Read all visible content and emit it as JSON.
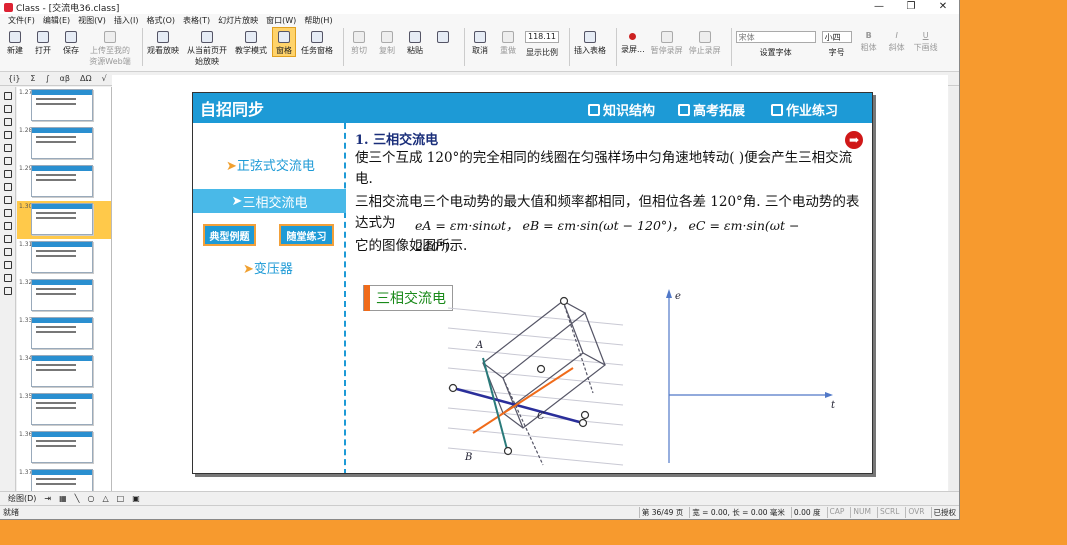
{
  "window": {
    "title": "Class - [交流电36.class]",
    "min": "—",
    "max": "❐",
    "close": "✕"
  },
  "menu": [
    "文件(F)",
    "编辑(E)",
    "视图(V)",
    "插入(I)",
    "格式(O)",
    "表格(T)",
    "幻灯片放映",
    "窗口(W)",
    "帮助(H)"
  ],
  "toolbar": {
    "new": "新建",
    "open": "打开",
    "save": "保存",
    "upload": "上传至我的资源Web端",
    "watch": "观看放映",
    "from_page": "从当前页开始放映",
    "teach_mode": "教学模式",
    "outline": "窗格",
    "task_pane": "任务窗格",
    "cut": "剪切",
    "copy": "复制",
    "paste": "粘贴",
    "undo": "取消",
    "redo": "重做",
    "zoom_value": "118.11",
    "zoom_label": "显示比例",
    "insert_table": "插入表格",
    "record": "录屏...",
    "pause_record": "暂停录屏",
    "stop_record": "停止录屏",
    "font_value": "宋体",
    "font_label": "设置字体",
    "size_value": "小四",
    "size_label": "字号",
    "bold": "粗体",
    "italic": "斜体",
    "underline": "下画线"
  },
  "toolbar2": [
    "{i}",
    "Σ",
    "∫",
    "αβ",
    "ΔΩ",
    "√",
    "∠",
    "±"
  ],
  "thumbnails": [
    "1.27",
    "1.28",
    "1.29",
    "1.30",
    "1.31",
    "1.32",
    "1.33",
    "1.34",
    "1.35",
    "1.36",
    "1.37"
  ],
  "selected_thumb": 3,
  "slide": {
    "header": "自招同步",
    "nav": {
      "structure": "知识结构",
      "expand": "高考拓展",
      "homework": "作业练习"
    },
    "left": {
      "item1": "正弦式交流电",
      "item2": "三相交流电",
      "btn1": "典型例题",
      "btn2": "随堂练习",
      "item3": "变压器"
    },
    "heading": "1. 三相交流电",
    "p1": "使三个互成 120°的完全相同的线圈在匀强样场中匀角速地转动(          )便会产生三相交流电.",
    "p2": "三相交流电三个电动势的最大值和频率都相同，但相位各差 120°角. 三个电动势的表达式为",
    "f1": "eA = εm·sinωt，",
    "f2": "eB = εm·sin(ωt − 120°)，",
    "f3": "eC = εm·sin(ωt − 240°).",
    "p3": "它的图像如图所示.",
    "label": "三相交流电",
    "diagram": {
      "A": "A",
      "B": "B",
      "C": "C",
      "axis_e": "e",
      "axis_t": "t"
    }
  },
  "drawbar": {
    "draw": "绘图(D)"
  },
  "status": {
    "ready": "就绪",
    "page": "第 36/49 页",
    "width": "宽 = 0.00, 长 = 0.00 毫米",
    "zoom": "0.00 度",
    "cap": "CAP",
    "num": "NUM",
    "scrl": "SCRL",
    "ovr": "OVR",
    "auth": "已授权"
  }
}
